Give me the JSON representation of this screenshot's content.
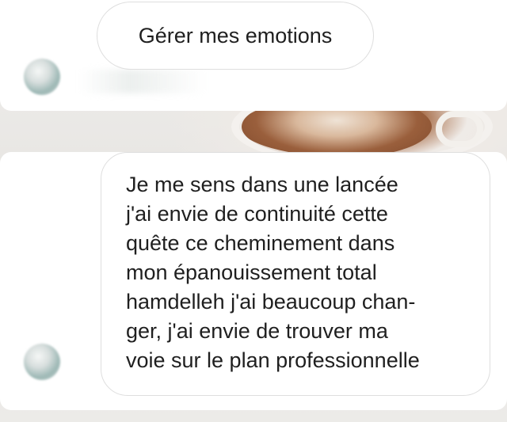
{
  "messages": [
    {
      "id": "top",
      "lines": [
        "Gérer mes emotions"
      ]
    },
    {
      "id": "bottom",
      "lines": [
        "Je me sens dans une lancée",
        "j'ai envie de continuité cette",
        "quête ce cheminement dans",
        "mon épanouissement total",
        "hamdelleh j'ai beaucoup chan-",
        "ger, j'ai envie de trouver ma",
        "voie sur le plan professionnelle"
      ]
    }
  ],
  "colors": {
    "panel": "#ffffff",
    "bubble_border": "#dedede",
    "text": "#1f1f1f",
    "background": "#e9e7e4"
  },
  "icons": [
    "avatar"
  ]
}
